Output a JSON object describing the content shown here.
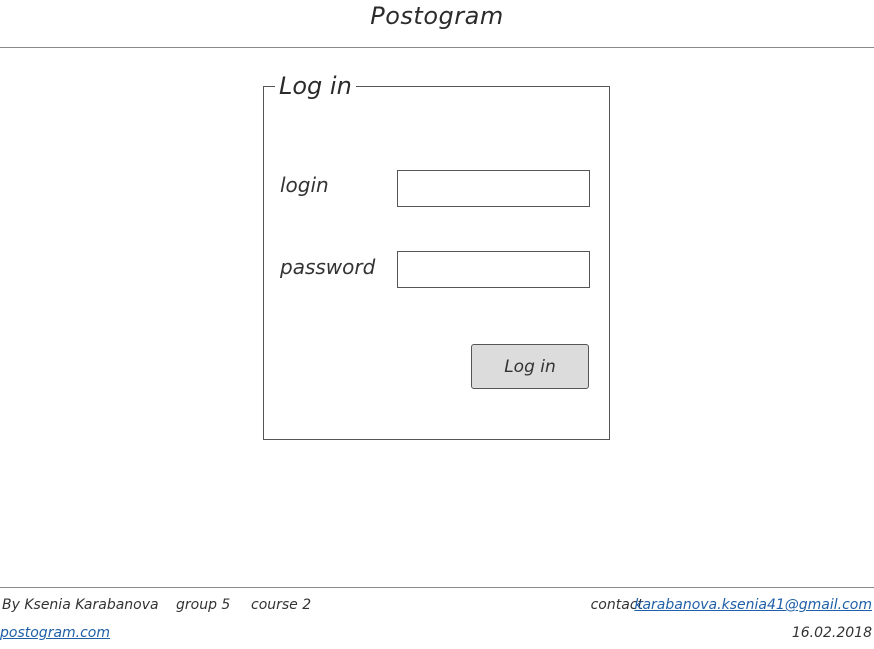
{
  "header": {
    "title": "Postogram"
  },
  "login_form": {
    "legend": "Log in",
    "login_label": "login",
    "login_value": "",
    "password_label": "password",
    "password_value": "",
    "submit_label": "Log in"
  },
  "footer": {
    "author": "By Ksenia Karabanova",
    "group": "group 5",
    "course": "course 2",
    "site_link": "postogram.com",
    "contact_label": "contact",
    "contact_email": "karabanova.ksenia41@gmail.com",
    "date": "16.02.2018"
  },
  "colors": {
    "link": "#1f5fa8",
    "button_bg": "#dcdcdc",
    "border": "#555555"
  }
}
